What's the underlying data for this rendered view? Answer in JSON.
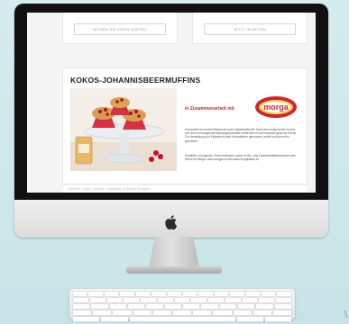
{
  "webpage": {
    "cards": [
      {
        "button_label": "NUTZEN SIE IHREN VORTEIL"
      },
      {
        "button_label": "JETZT IN AKTION"
      }
    ],
    "article": {
      "title": "KOKOS-JOHANNISBEERMUFFINS",
      "partner_text": "in Zusammenarbeit mit",
      "partner_logo_text": "morga",
      "paragraph_1": "Kokosmehl ist sowohl fettarm als auch ballaststoffreich. Dank dem entsprechen Aroma und den herrorragenden Backeigenschaften bereichert es die leckerste gesunde Küche. Zur Herstellung von Kokosmehl wird Kokosfleisch getrocknet, entölt und dann fein gemahlen.",
      "paragraph_2": "Erhältlich in Drogerien, Reformhäusern sowie im Bio- und Lebensmittelfachhandel oder direkt bei Morga. www.morga.ch oder www.morgaskafe.ch"
    },
    "next_section_heading": "Weitere Tipps, Küchen- Klassiker & Backs Rezepte"
  },
  "edge_glyph": "\\"
}
